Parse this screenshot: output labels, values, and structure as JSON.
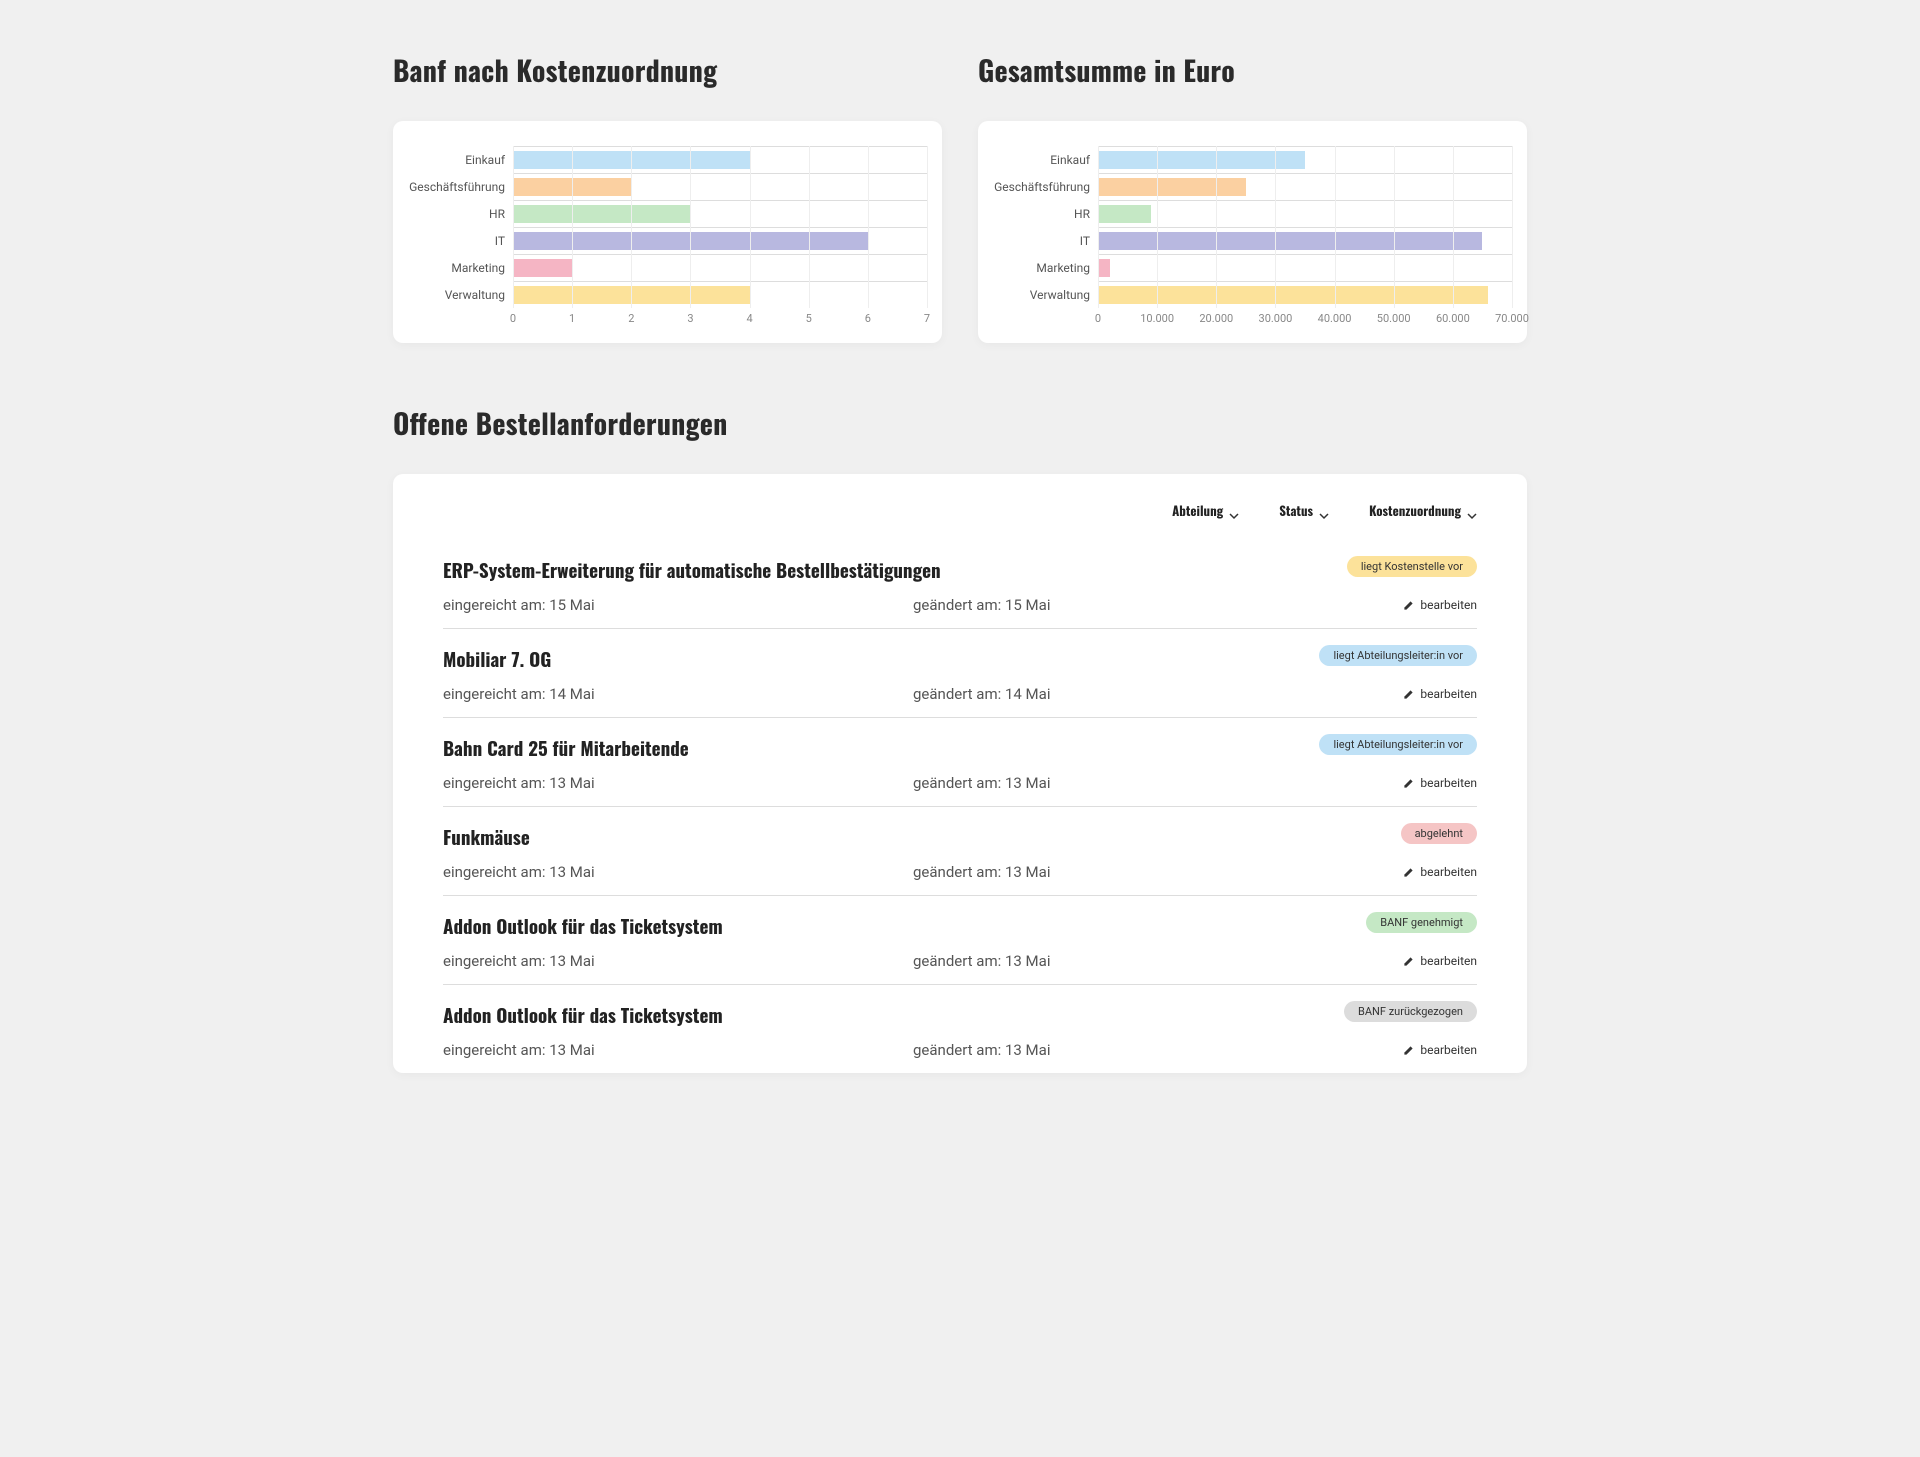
{
  "charts": {
    "left": {
      "title": "Banf nach Kostenzuordnung",
      "categories": [
        "Einkauf",
        "Geschäftsführung",
        "HR",
        "IT",
        "Marketing",
        "Verwaltung"
      ],
      "values": [
        4,
        2,
        3,
        6,
        1,
        4
      ],
      "colors": [
        "#bfe1f6",
        "#fbd0a1",
        "#c5e8c5",
        "#b8b8e0",
        "#f5b5c4",
        "#fce29a"
      ],
      "xmax": 7,
      "ticks": [
        "0",
        "1",
        "2",
        "3",
        "4",
        "5",
        "6",
        "7"
      ]
    },
    "right": {
      "title": "Gesamtsumme in Euro",
      "categories": [
        "Einkauf",
        "Geschäftsführung",
        "HR",
        "IT",
        "Marketing",
        "Verwaltung"
      ],
      "values": [
        35000,
        25000,
        9000,
        65000,
        2000,
        66000
      ],
      "colors": [
        "#bfe1f6",
        "#fbd0a1",
        "#c5e8c5",
        "#b8b8e0",
        "#f5b5c4",
        "#fce29a"
      ],
      "xmax": 70000,
      "ticks": [
        "0",
        "10.000",
        "20.000",
        "30.000",
        "40.000",
        "50.000",
        "60.000",
        "70.000"
      ]
    }
  },
  "chart_data": [
    {
      "type": "bar",
      "orientation": "horizontal",
      "title": "Banf nach Kostenzuordnung",
      "categories": [
        "Einkauf",
        "Geschäftsführung",
        "HR",
        "IT",
        "Marketing",
        "Verwaltung"
      ],
      "values": [
        4,
        2,
        3,
        6,
        1,
        4
      ],
      "xlabel": "",
      "ylabel": "",
      "xlim": [
        0,
        7
      ]
    },
    {
      "type": "bar",
      "orientation": "horizontal",
      "title": "Gesamtsumme in Euro",
      "categories": [
        "Einkauf",
        "Geschäftsführung",
        "HR",
        "IT",
        "Marketing",
        "Verwaltung"
      ],
      "values": [
        35000,
        25000,
        9000,
        65000,
        2000,
        66000
      ],
      "xlabel": "",
      "ylabel": "",
      "xlim": [
        0,
        70000
      ]
    }
  ],
  "orders": {
    "title": "Offene Bestellanforderungen",
    "filters": {
      "department": "Abteilung",
      "status": "Status",
      "cost": "Kostenzuordnung"
    },
    "submitted_prefix": "eingereicht am: ",
    "changed_prefix": "geändert am: ",
    "edit_label": "bearbeiten",
    "items": [
      {
        "title": "ERP-System-Erweiterung für automatische Bestellbestätigungen",
        "submitted": "15 Mai",
        "changed": "15 Mai",
        "status": "liegt Kostenstelle vor",
        "status_color": "#fce29a"
      },
      {
        "title": "Mobiliar 7. OG",
        "submitted": "14 Mai",
        "changed": "14 Mai",
        "status": "liegt Abteilungsleiter:in vor",
        "status_color": "#bfe1f6"
      },
      {
        "title": "Bahn Card 25 für Mitarbeitende",
        "submitted": "13 Mai",
        "changed": "13 Mai",
        "status": "liegt Abteilungsleiter:in vor",
        "status_color": "#bfe1f6"
      },
      {
        "title": "Funkmäuse",
        "submitted": "13 Mai",
        "changed": "13 Mai",
        "status": "abgelehnt",
        "status_color": "#f5c5c5"
      },
      {
        "title": "Addon Outlook für das Ticketsystem",
        "submitted": "13 Mai",
        "changed": "13 Mai",
        "status": "BANF genehmigt",
        "status_color": "#c5e8c5"
      },
      {
        "title": "Addon Outlook für das Ticketsystem",
        "submitted": "13 Mai",
        "changed": "13 Mai",
        "status": "BANF zurückgezogen",
        "status_color": "#dcdcdc"
      }
    ]
  }
}
